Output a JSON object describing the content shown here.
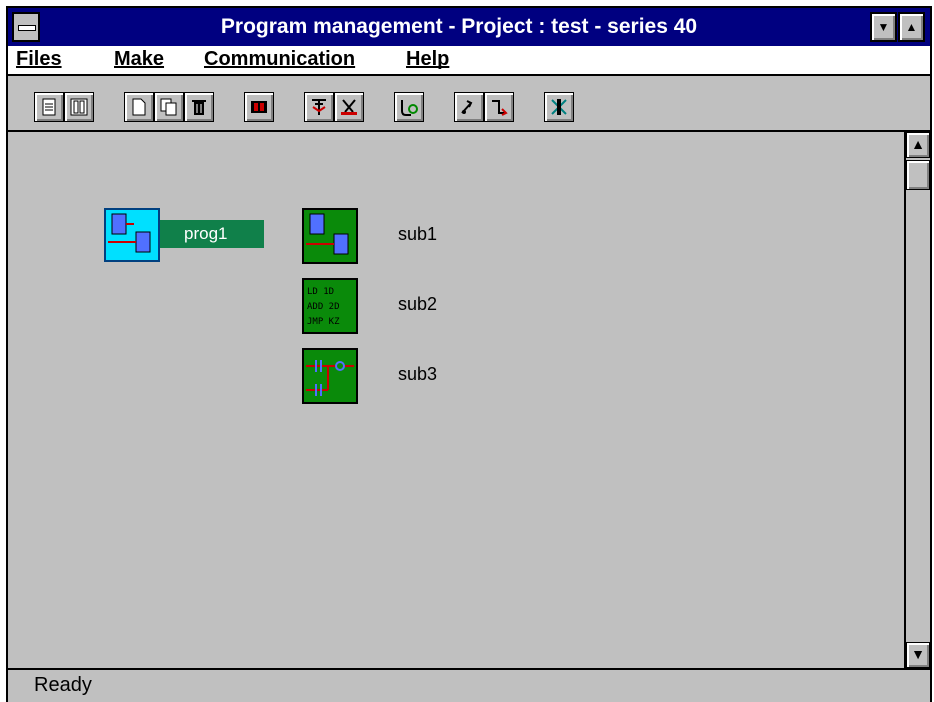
{
  "window": {
    "title": "Program management -  Project : test  - series 40"
  },
  "controls": {
    "minimize": "▼",
    "maximize": "▲"
  },
  "menu": {
    "items": [
      "Files",
      "Make",
      "Communication",
      "Help"
    ]
  },
  "toolbar": {
    "buttons": [
      "open-project-icon",
      "view-project-icon",
      "new-program-icon",
      "copy-program-icon",
      "delete-icon",
      "edit-icon",
      "compile-icon",
      "cut-icon",
      "link-icon",
      "transfer-icon",
      "connect-icon",
      "debug-icon"
    ]
  },
  "programs": {
    "main": {
      "label": "prog1",
      "icon": "program-icon",
      "selected": true
    },
    "subs": [
      {
        "label": "sub1",
        "icon": "program-icon"
      },
      {
        "label": "sub2",
        "icon": "instruction-list-icon",
        "icon_text": [
          "LD  1D",
          "ADD 2D",
          "JMP KZ"
        ]
      },
      {
        "label": "sub3",
        "icon": "ladder-icon"
      }
    ]
  },
  "scrollbar": {
    "up": "▲",
    "down": "▼"
  },
  "status": {
    "text": "Ready"
  },
  "colors": {
    "title_bar": "#000080",
    "selected_icon_bg": "#00e0ff",
    "selected_label_bg": "#10804a",
    "sub_icon_bg": "#0a8a0a"
  }
}
